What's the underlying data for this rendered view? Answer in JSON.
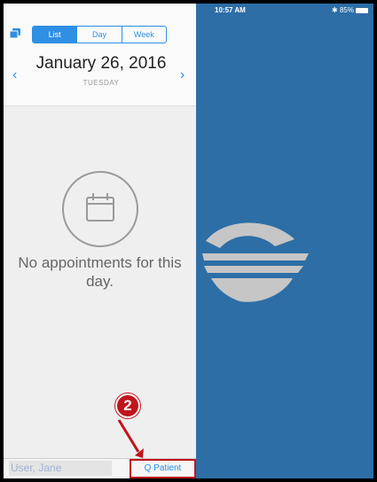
{
  "status_bar": {
    "device": "iPad",
    "wifi_icon": "wifi-icon",
    "time": "10:57 AM",
    "bluetooth": "✱",
    "battery": "85%"
  },
  "sidebar": {
    "calendar_toggle_icon": "calendar-stack-icon",
    "view_tabs": [
      {
        "label": "List",
        "active": true
      },
      {
        "label": "Day",
        "active": false
      },
      {
        "label": "Week",
        "active": false
      }
    ],
    "prev_icon": "‹",
    "next_icon": "›",
    "date": "January 26, 2016",
    "weekday": "TUESDAY",
    "empty_icon": "calendar-icon",
    "empty_message": "No appointments for this day.",
    "user": "User, Jane",
    "patient_button": "Q Patient"
  },
  "annotation": {
    "step_number": "2",
    "color": "#c0151b"
  },
  "colors": {
    "accent": "#2f8fe3",
    "background": "#2d6ea6",
    "highlight": "#c0151b"
  }
}
